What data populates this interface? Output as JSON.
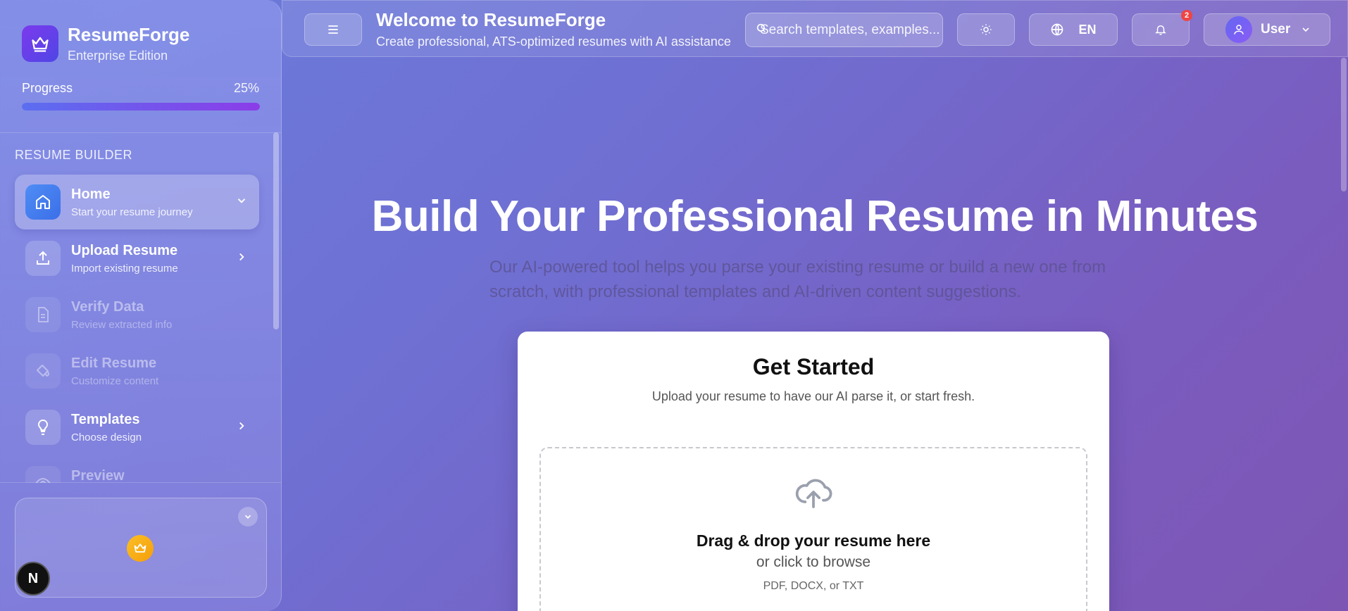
{
  "sidebar": {
    "brand_name": "ResumeForge",
    "brand_edition": "Enterprise Edition",
    "progress_label": "Progress",
    "progress_value": "25%",
    "section_title": "RESUME BUILDER",
    "items": [
      {
        "title": "Home",
        "subtitle": "Start your resume journey",
        "icon": "home-icon",
        "state": "active"
      },
      {
        "title": "Upload Resume",
        "subtitle": "Import existing resume",
        "icon": "upload-icon",
        "state": "enabled"
      },
      {
        "title": "Verify Data",
        "subtitle": "Review extracted info",
        "icon": "document-icon",
        "state": "disabled"
      },
      {
        "title": "Edit Resume",
        "subtitle": "Customize content",
        "icon": "paint-bucket-icon",
        "state": "disabled"
      },
      {
        "title": "Templates",
        "subtitle": "Choose design",
        "icon": "lightbulb-icon",
        "state": "enabled"
      },
      {
        "title": "Preview",
        "subtitle": "",
        "icon": "eye-icon",
        "state": "disabled"
      }
    ],
    "dev_badge": "N"
  },
  "header": {
    "title": "Welcome to ResumeForge",
    "subtitle": "Create professional, ATS-optimized resumes with AI assistance",
    "search_placeholder": "Search templates, examples...",
    "language": "EN",
    "notification_count": "2",
    "user_label": "User"
  },
  "hero": {
    "title": "Build Your Professional Resume in Minutes",
    "description": "Our AI-powered tool helps you parse your existing resume or build a new one from scratch, with professional templates and AI-driven content suggestions."
  },
  "get_started": {
    "title": "Get Started",
    "subtitle": "Upload your resume to have our AI parse it, or start fresh.",
    "drop_title": "Drag & drop your resume here",
    "drop_sub": "or click to browse",
    "drop_formats": "PDF, DOCX, or TXT"
  },
  "colors": {
    "accent": "#4f46e5",
    "progress_start": "#5b6ef0",
    "progress_end": "#8b3de8",
    "badge": "#ef4444"
  }
}
